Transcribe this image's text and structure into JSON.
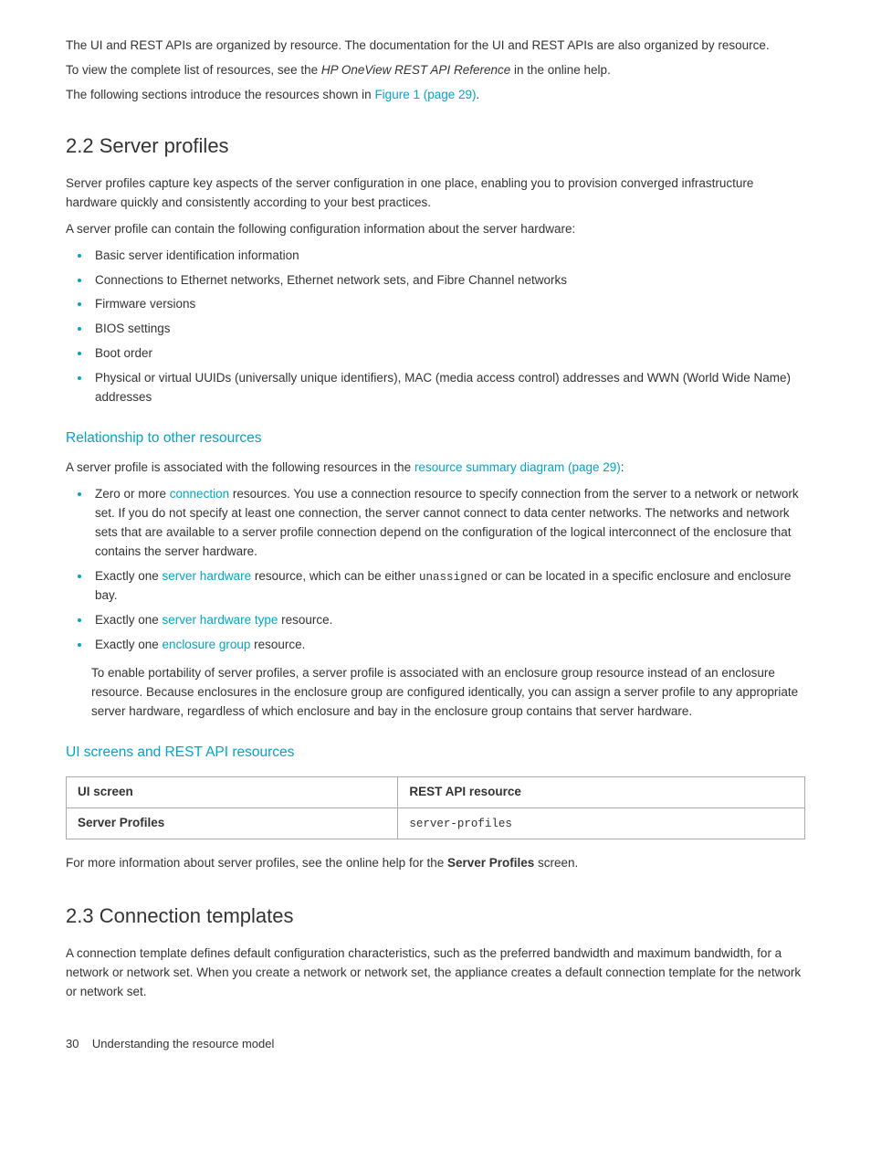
{
  "intro": {
    "line1": "The UI and REST APIs are organized by resource. The documentation for the UI and REST APIs are also organized by resource.",
    "line2_prefix": "To view the complete list of resources, see the ",
    "line2_italic": "HP OneView REST API Reference",
    "line2_suffix": " in the online help.",
    "line3_prefix": "The following sections introduce the resources shown in ",
    "line3_link": "Figure 1 (page 29)",
    "line3_suffix": "."
  },
  "section22": {
    "heading_num": "2.2",
    "heading_title": "Server profiles",
    "p1": "Server profiles capture key aspects of the server configuration in one place, enabling you to provision converged infrastructure hardware quickly and consistently according to your best practices.",
    "p2": "A server profile can contain the following configuration information about the server hardware:",
    "bullets": [
      "Basic server identification information",
      "Connections to Ethernet networks, Ethernet network sets, and Fibre Channel networks",
      "Firmware versions",
      "BIOS settings",
      "Boot order",
      "Physical or virtual UUIDs (universally unique identifiers), MAC (media access control) addresses and WWN (World Wide Name) addresses"
    ],
    "relationship": {
      "heading": "Relationship to other resources",
      "p1_prefix": "A server profile is associated with the following resources in the ",
      "p1_link": "resource summary diagram (page 29)",
      "p1_suffix": ":",
      "bullets": [
        {
          "prefix": "Zero or more ",
          "link": "connection",
          "suffix": " resources. You use a connection resource to specify connection from the server to a network or network set. If you do not specify at least one connection, the server cannot connect to data center networks. The networks and network sets that are available to a server profile connection depend on the configuration of the logical interconnect of the enclosure that contains the server hardware."
        },
        {
          "prefix": "Exactly one ",
          "link": "server hardware",
          "suffix_prefix": " resource, which can be either ",
          "mono": "unassigned",
          "suffix": " or can be located in a specific enclosure and enclosure bay."
        },
        {
          "prefix": "Exactly one ",
          "link": "server hardware type",
          "suffix": " resource."
        },
        {
          "prefix": "Exactly one ",
          "link": "enclosure group",
          "suffix": " resource."
        }
      ],
      "p_portability": "To enable portability of server profiles, a server profile is associated with an enclosure group resource instead of an enclosure resource. Because enclosures in the enclosure group are configured identically, you can assign a server profile to any appropriate server hardware, regardless of which enclosure and bay in the enclosure group contains that server hardware."
    },
    "ui_rest": {
      "heading": "UI screens and REST API resources",
      "table": {
        "headers": [
          "UI screen",
          "REST API resource"
        ],
        "rows": [
          [
            "Server Profiles",
            "server-profiles"
          ]
        ]
      },
      "footer_prefix": "For more information about server profiles, see the online help for the ",
      "footer_bold": "Server Profiles",
      "footer_suffix": " screen."
    }
  },
  "section23": {
    "heading_num": "2.3",
    "heading_title": "Connection templates",
    "p1": "A connection template defines default configuration characteristics, such as the preferred bandwidth and maximum bandwidth, for a network or network set. When you create a network or network set, the appliance creates a default connection template for the network or network set."
  },
  "page_footer": {
    "page_num": "30",
    "text": "Understanding the resource model"
  }
}
